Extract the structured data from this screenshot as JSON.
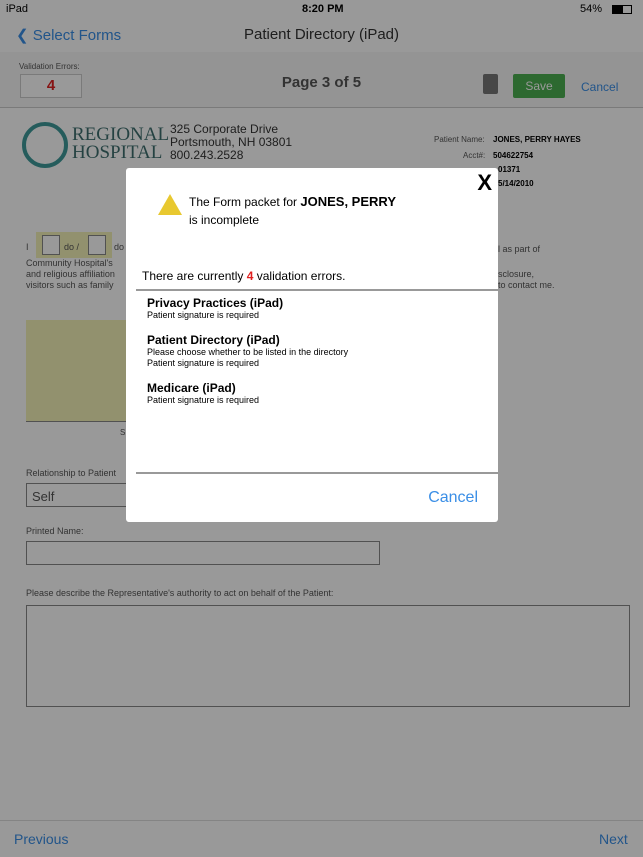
{
  "status": {
    "device": "iPad",
    "time": "8:20 PM",
    "battery": "54%"
  },
  "nav": {
    "back": "Select Forms",
    "title": "Patient Directory (iPad)"
  },
  "toolbar": {
    "errors_label": "Validation Errors:",
    "errors_count": "4",
    "page": "Page 3 of 5",
    "save": "Save",
    "cancel": "Cancel"
  },
  "header": {
    "logo_line1": "REGIONAL",
    "logo_line2": "HOSPITAL",
    "address1": "325 Corporate Drive",
    "address2": "Portsmouth, NH 03801",
    "phone": "800.243.2528",
    "patient_label": "Patient Name:",
    "patient": "JONES, PERRY HAYES",
    "acct_label": "Acct#:",
    "acct": "504622754",
    "mrn_partial": "01371",
    "dob_partial": "5/14/2010"
  },
  "form": {
    "i": "I",
    "do": "do /",
    "do2": "do",
    "line1_right": "l as part of",
    "line2": "Community Hospital's",
    "line3": "and religious affiliation",
    "line3_right": "sclosure,",
    "line4": "visitors such as family",
    "line4_right": "to contact me.",
    "sig_caption": "S",
    "relationship_label": "Relationship to Patient",
    "relationship_value": "Self",
    "printed_name_label": "Printed Name:",
    "authority_label": "Please describe the Representative's authority to act on behalf of the Patient:"
  },
  "footer": {
    "previous": "Previous",
    "next": "Next"
  },
  "modal": {
    "close": "X",
    "msg_pre": "The Form packet for",
    "patient": "JONES, PERRY",
    "msg_post": "is incomplete",
    "count_pre": "There are currently",
    "count": "4",
    "count_post": "validation errors.",
    "errors": [
      {
        "form": "Privacy Practices (iPad)",
        "items": [
          "Patient signature is required"
        ]
      },
      {
        "form": "Patient Directory (iPad)",
        "items": [
          "Please choose whether to be listed in the directory",
          "Patient signature is required"
        ]
      },
      {
        "form": "Medicare (iPad)",
        "items": [
          "Patient signature is required"
        ]
      }
    ],
    "cancel": "Cancel"
  },
  "colors": {
    "accent": "#3a8ee6",
    "error": "#e02020",
    "save": "#4caf50",
    "logo": "#3f9a9a"
  }
}
